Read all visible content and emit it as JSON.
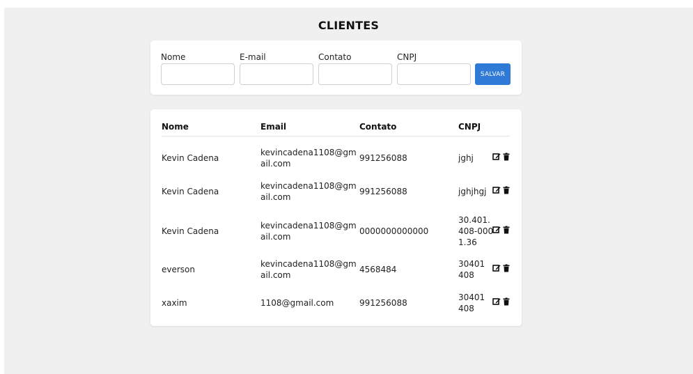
{
  "page": {
    "title": "CLIENTES"
  },
  "form": {
    "fields": [
      {
        "label": "Nome",
        "value": ""
      },
      {
        "label": "E-mail",
        "value": ""
      },
      {
        "label": "Contato",
        "value": ""
      },
      {
        "label": "CNPJ",
        "value": ""
      }
    ],
    "save_label": "SALVAR",
    "accent_color": "#2f7ad6"
  },
  "table": {
    "headers": [
      "Nome",
      "Email",
      "Contato",
      "CNPJ"
    ],
    "rows": [
      {
        "name": "Kevin Cadena",
        "email": "kevincadena1108@gmail.com",
        "contact": "991256088",
        "cnpj": "jghj"
      },
      {
        "name": "Kevin Cadena",
        "email": "kevincadena1108@gmail.com",
        "contact": "991256088",
        "cnpj": "jghjhgj"
      },
      {
        "name": "Kevin Cadena",
        "email": "kevincadena1108@gmail.com",
        "contact": "0000000000000",
        "cnpj": "30.401.408-0001.36"
      },
      {
        "name": "everson",
        "email": "kevincadena1108@gmail.com",
        "contact": "4568484",
        "cnpj": "30401408"
      },
      {
        "name": "xaxim",
        "email": "1108@gmail.com",
        "contact": "991256088",
        "cnpj": "30401408"
      }
    ],
    "row_icons": [
      "edit-icon",
      "trash-icon"
    ]
  }
}
